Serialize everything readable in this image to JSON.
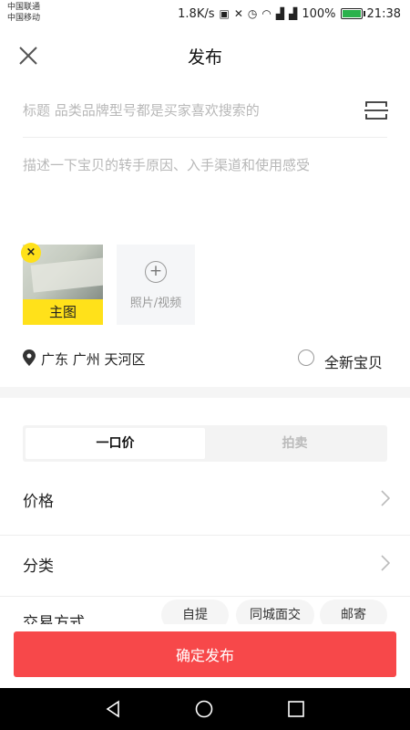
{
  "status_bar": {
    "carrier_1": "中国联通",
    "carrier_2": "中国移动",
    "net_speed": "1.8K/s",
    "battery": "100%",
    "time": "21:38"
  },
  "header": {
    "title": "发布"
  },
  "form": {
    "title_placeholder": "标题 品类品牌型号都是买家喜欢搜索的",
    "desc_placeholder": "描述一下宝贝的转手原因、入手渠道和使用感受"
  },
  "media": {
    "main_badge": "主图",
    "remove_glyph": "×",
    "add_label": "照片/视频",
    "add_glyph": "+"
  },
  "location": {
    "text": "广东 广州 天河区"
  },
  "condition": {
    "label": "全新宝贝",
    "checked": false
  },
  "pricing_tabs": [
    {
      "label": "一口价",
      "active": true
    },
    {
      "label": "拍卖",
      "active": false
    }
  ],
  "rows": [
    {
      "label": "价格"
    },
    {
      "label": "分类"
    }
  ],
  "trade": {
    "label": "交易方式",
    "options": [
      "自提",
      "同城面交",
      "邮寄"
    ]
  },
  "submit": {
    "label": "确定发布"
  },
  "colors": {
    "accent_yellow": "#ffe11a",
    "submit_red": "#f7484a"
  }
}
